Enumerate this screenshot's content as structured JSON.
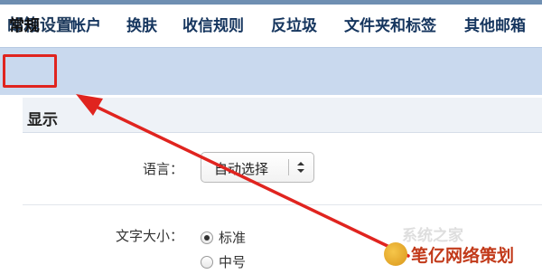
{
  "page": {
    "title": "邮箱设置"
  },
  "tabs": [
    {
      "label": "常规",
      "active": true
    },
    {
      "label": "帐户"
    },
    {
      "label": "换肤"
    },
    {
      "label": "收信规则"
    },
    {
      "label": "反垃圾"
    },
    {
      "label": "文件夹和标签"
    },
    {
      "label": "其他邮箱"
    }
  ],
  "section": {
    "title": "显示"
  },
  "language": {
    "label": "语言：",
    "selected": "自动选择"
  },
  "font_size": {
    "label": "文字大小：",
    "options": [
      {
        "label": "标准",
        "checked": true
      },
      {
        "label": "中号",
        "checked": false
      }
    ]
  },
  "colors": {
    "accent": "#e0241f",
    "tabbar": "#c9d9ee",
    "tab_text": "#15355e"
  },
  "watermark": {
    "text": "笔亿网络策划",
    "faint_text": "系统之家"
  }
}
